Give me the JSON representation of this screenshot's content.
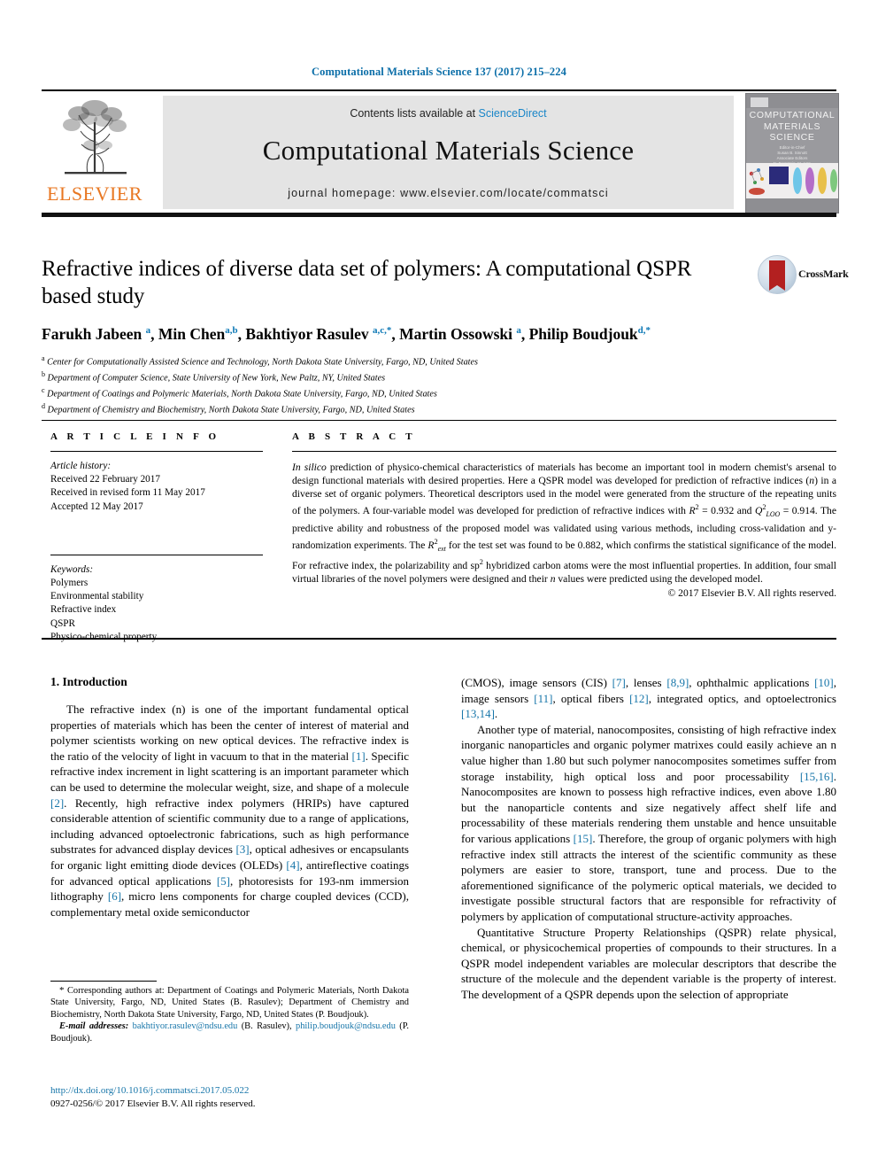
{
  "running_head": "Computational Materials Science 137 (2017) 215–224",
  "masthead": {
    "publisher_name": "ELSEVIER",
    "contents_prefix": "Contents lists available at ",
    "sciencedirect": "ScienceDirect",
    "journal_title": "Computational Materials Science",
    "homepage": "journal homepage: www.elsevier.com/locate/commatsci",
    "cover": {
      "line1": "COMPUTATIONAL",
      "line2": "MATERIALS",
      "line3": "SCIENCE",
      "editors": "Editor-in-Chief\nSusan B. Sinnott\nAssociate Editors\nN. Bernstein  M. Asta\nD. Morgan  G. Ceder"
    }
  },
  "article": {
    "title": "Refractive indices of diverse data set of polymers: A computational QSPR based study",
    "crossmark_label": "CrossMark",
    "authors_html": "Farukh Jabeen <sup>a</sup>, Min Chen<sup>a,b</sup>, Bakhtiyor Rasulev <sup>a,c,*</sup>, Martin Ossowski <sup>a</sup>, Philip Boudjouk<sup>d,*</sup>",
    "affiliations": [
      {
        "marker": "a",
        "text": "Center for Computationally Assisted Science and Technology, North Dakota State University, Fargo, ND, United States"
      },
      {
        "marker": "b",
        "text": "Department of Computer Science, State University of New York, New Paltz, NY, United States"
      },
      {
        "marker": "c",
        "text": "Department of Coatings and Polymeric Materials, North Dakota State University, Fargo, ND, United States"
      },
      {
        "marker": "d",
        "text": "Department of Chemistry and Biochemistry, North Dakota State University, Fargo, ND, United States"
      }
    ]
  },
  "article_info": {
    "heading": "A R T I C L E   I N F O",
    "history_label": "Article history:",
    "history": [
      "Received 22 February 2017",
      "Received in revised form 11 May 2017",
      "Accepted 12 May 2017"
    ],
    "keywords_label": "Keywords:",
    "keywords": [
      "Polymers",
      "Environmental stability",
      "Refractive index",
      "QSPR",
      "Physico-chemical property"
    ]
  },
  "abstract": {
    "heading": "A B S T R A C T",
    "html": "<i>In silico</i> prediction of physico-chemical characteristics of materials has become an important tool in modern chemist's arsenal to design functional materials with desired properties. Here a QSPR model was developed for prediction of refractive indices (<i>n</i>) in a diverse set of organic polymers. Theoretical descriptors used in the model were generated from the structure of the repeating units of the polymers. A four-variable model was developed for prediction of refractive indices with <i>R</i><sup class=\"s\">2</sup> = 0.932 and <i>Q</i><sup class=\"s\">2</sup><sub class=\"s\"><i>LOO</i></sub> = 0.914. The predictive ability and robustness of the proposed model was validated using various methods, including cross-validation and y-randomization experiments. The <i>R</i><sup class=\"s\">2</sup><sub class=\"s\"><i>ext</i></sub> for the test set was found to be 0.882, which confirms the statistical significance of the model. For refractive index, the polarizability and sp<sup class=\"s\">2</sup> hybridized carbon atoms were the most influential properties. In addition, four small virtual libraries of the novel polymers were designed and their <i>n</i> values were predicted using the developed model.",
    "copyright": "© 2017 Elsevier B.V. All rights reserved."
  },
  "introduction": {
    "heading": "1. Introduction",
    "left_paragraphs_html": [
      "The refractive index (n) is one of the important fundamental optical properties of materials which has been the center of interest of material and polymer scientists working on new optical devices. The refractive index is the ratio of the velocity of light in vacuum to that in the material <span class=\"cite\">[1]</span>. Specific refractive index increment in light scattering is an important parameter which can be used to determine the molecular weight, size, and shape of a molecule <span class=\"cite\">[2]</span>. Recently, high refractive index polymers (HRIPs) have captured considerable attention of scientific community due to a range of applications, including advanced optoelectronic fabrications, such as high performance substrates for advanced display devices <span class=\"cite\">[3]</span>, optical adhesives or encapsulants for organic light emitting diode devices (OLEDs) <span class=\"cite\">[4]</span>, antireflective coatings for advanced optical applications <span class=\"cite\">[5]</span>, photoresists for 193-nm immersion lithography <span class=\"cite\">[6]</span>, micro lens components for charge coupled devices (CCD), complementary metal oxide semiconductor"
    ],
    "right_paragraphs_html": [
      "(CMOS), image sensors (CIS) <span class=\"cite\">[7]</span>, lenses <span class=\"cite\">[8,9]</span>, ophthalmic applications <span class=\"cite\">[10]</span>, image sensors <span class=\"cite\">[11]</span>, optical fibers <span class=\"cite\">[12]</span>, integrated optics, and optoelectronics <span class=\"cite\">[13,14]</span>.",
      "Another type of material, nanocomposites, consisting of high refractive index inorganic nanoparticles and organic polymer matrixes could easily achieve an n value higher than 1.80 but such polymer nanocomposites sometimes suffer from storage instability, high optical loss and poor processability <span class=\"cite\">[15,16]</span>. Nanocomposites are known to possess high refractive indices, even above 1.80 but the nanoparticle contents and size negatively affect shelf life and processability of these materials rendering them unstable and hence unsuitable for various applications <span class=\"cite\">[15]</span>. Therefore, the group of organic polymers with high refractive index still attracts the interest of the scientific community as these polymers are easier to store, transport, tune and process. Due to the aforementioned significance of the polymeric optical materials, we decided to investigate possible structural factors that are responsible for refractivity of polymers by application of computational structure-activity approaches.",
      "Quantitative Structure Property Relationships (QSPR) relate physical, chemical, or physicochemical properties of compounds to their structures. In a QSPR model independent variables are molecular descriptors that describe the structure of the molecule and the dependent variable is the property of interest. The development of a QSPR depends upon the selection of appropriate"
    ]
  },
  "footnotes": {
    "corresponding_html": "<span style=\"font-size:11px\">*</span> Corresponding authors at: Department of Coatings and Polymeric Materials, North Dakota State University, Fargo, ND, United States (B. Rasulev); Department of Chemistry and Biochemistry, North Dakota State University, Fargo, ND, United States (P. Boudjouk).",
    "email_label": "E-mail addresses:",
    "email_html": " <span class=\"link\">bakhtiyor.rasulev@ndsu.edu</span> (B. Rasulev), <span class=\"link\">philip.boudjouk@ndsu.edu</span> (P. Boudjouk)."
  },
  "footer": {
    "doi": "http://dx.doi.org/10.1016/j.commatsci.2017.05.022",
    "issn_copyright": "0927-0256/© 2017 Elsevier B.V. All rights reserved."
  },
  "colors": {
    "accent_blue": "#1675a9",
    "header_blue": "#0b6ea8",
    "elsevier_orange": "#E87722",
    "sciencedirect_blue": "#1a86c8",
    "band_gray": "#e4e4e4"
  }
}
